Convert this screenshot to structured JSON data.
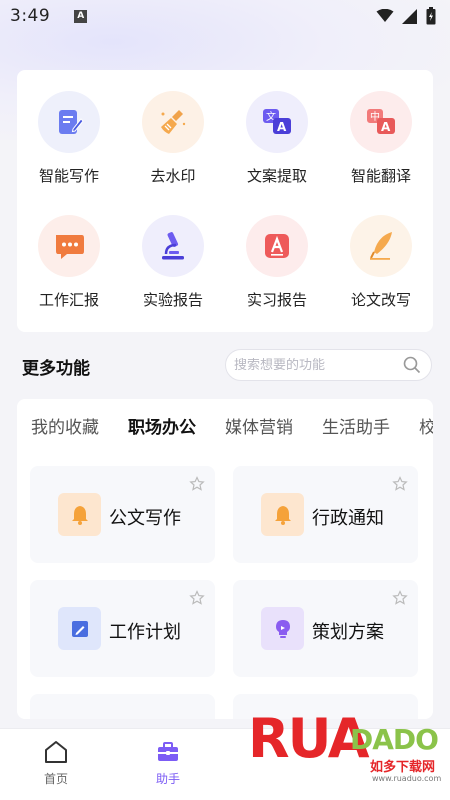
{
  "status_bar": {
    "time": "3:49",
    "notification_badge": "A"
  },
  "tools": [
    {
      "label": "智能写作",
      "icon": "pen-note-icon",
      "bg": "#eef0fb"
    },
    {
      "label": "去水印",
      "icon": "broom-icon",
      "bg": "#fdf1e6"
    },
    {
      "label": "文案提取",
      "icon": "text-extract-icon",
      "bg": "#efeefc"
    },
    {
      "label": "智能翻译",
      "icon": "translate-icon",
      "bg": "#fdecec"
    },
    {
      "label": "工作汇报",
      "icon": "chat-bubble-icon",
      "bg": "#fdeeea"
    },
    {
      "label": "实验报告",
      "icon": "microscope-icon",
      "bg": "#efeefc"
    },
    {
      "label": "实习报告",
      "icon": "letter-a-icon",
      "bg": "#fdecec"
    },
    {
      "label": "论文改写",
      "icon": "feather-pen-icon",
      "bg": "#fdf3e8"
    }
  ],
  "more_section": {
    "title": "更多功能",
    "search_placeholder": "搜索想要的功能"
  },
  "tabs": [
    {
      "label": "我的收藏",
      "active": false
    },
    {
      "label": "职场办公",
      "active": true
    },
    {
      "label": "媒体营销",
      "active": false
    },
    {
      "label": "生活助手",
      "active": false
    },
    {
      "label": "校",
      "active": false
    }
  ],
  "function_cards": [
    {
      "label": "公文写作",
      "icon": "bell-icon",
      "icon_bg": "#fde6cf"
    },
    {
      "label": "行政通知",
      "icon": "bell-icon",
      "icon_bg": "#fde6cf"
    },
    {
      "label": "工作计划",
      "icon": "edit-board-icon",
      "icon_bg": "#dfe6fb"
    },
    {
      "label": "策划方案",
      "icon": "lightbulb-icon",
      "icon_bg": "#e9e1fb"
    }
  ],
  "bottom_nav": [
    {
      "label": "首页",
      "icon": "home-icon",
      "active": false
    },
    {
      "label": "助手",
      "icon": "toolbox-icon",
      "active": true
    }
  ],
  "watermark": {
    "big_text": "RUA",
    "small_text": "DADO",
    "chinese_text": "如多下载网",
    "url": "www.ruaduo.com"
  },
  "colors": {
    "accent": "#7c5cf5",
    "watermark_red": "#e52629",
    "watermark_green": "#8bc34a"
  }
}
